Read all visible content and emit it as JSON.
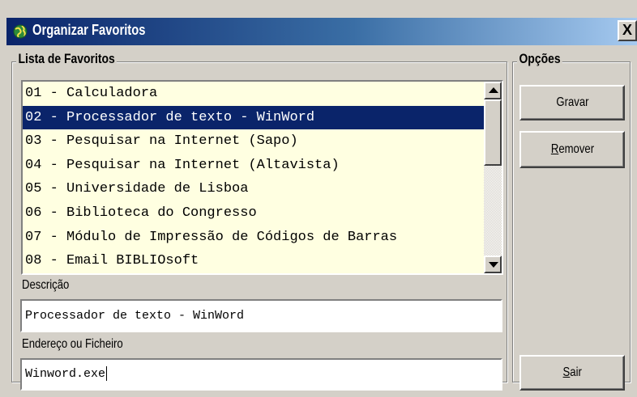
{
  "window": {
    "title": "Organizar Favoritos",
    "close_label": "X"
  },
  "favorites": {
    "group_label": "Lista de Favoritos",
    "selected_index": 1,
    "items": [
      "01 - Calculadora",
      "02 - Processador de texto - WinWord",
      "03 - Pesquisar na Internet (Sapo)",
      "04 - Pesquisar na Internet (Altavista)",
      "05 - Universidade de Lisboa",
      "06 - Biblioteca do Congresso",
      "07 - Módulo de Impressão de Códigos de Barras",
      "08 - Email BIBLIOsoft"
    ]
  },
  "description": {
    "label": "Descrição",
    "value": "Processador de texto - WinWord"
  },
  "address": {
    "label": "Endereço ou Ficheiro",
    "value": "Winword.exe"
  },
  "options": {
    "group_label": "Opções",
    "save_label": "Gravar",
    "remove_label_mnemonic": "R",
    "remove_label_rest": "emover",
    "exit_label_mnemonic": "S",
    "exit_label_rest": "air"
  },
  "colors": {
    "list_background": "#ffffe1",
    "selection": "#0a246a",
    "dialog_face": "#d4d0c8"
  }
}
